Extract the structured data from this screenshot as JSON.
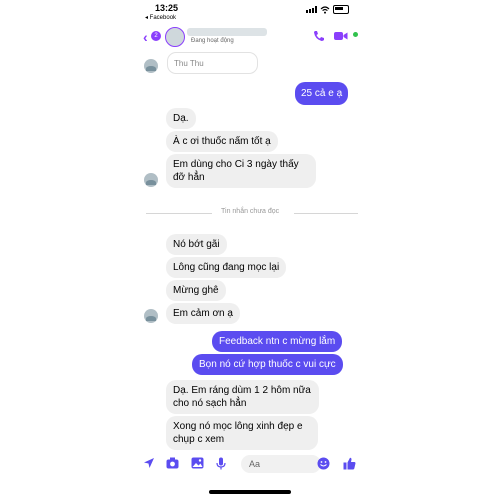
{
  "status_bar": {
    "time": "13:25",
    "back_app": "◂ Facebook"
  },
  "header": {
    "back_count": "2",
    "contact_status": "Đang hoạt động"
  },
  "messages": {
    "quoted": "Thu Thu",
    "m1": "25 cả e ạ",
    "m2": "Dạ.",
    "m3": "À c ơi thuốc nấm tốt ạ",
    "m4": "Em dùng cho Ci 3 ngày thấy đỡ hẳn",
    "m5": "Nó bớt gãi",
    "m6": "Lông cũng đang mọc lại",
    "m7": "Mừng ghê",
    "m8": "Em cảm ơn ạ",
    "m9": "Feedback ntn c mừng lắm",
    "m10": "Bọn nó cứ hợp thuốc c vui cực",
    "m11": "Dạ. Em ráng dùm 1 2 hôm nữa cho nó sạch hẳn",
    "m12": "Xong nó mọc lông xinh đẹp e chụp c xem"
  },
  "divider": {
    "label": "Tin nhắn chưa đọc"
  },
  "composer": {
    "placeholder": "Aa"
  },
  "colors": {
    "accent": "#8a3ffc",
    "outgoing": "#5b4cf0",
    "incoming": "#efefef"
  }
}
